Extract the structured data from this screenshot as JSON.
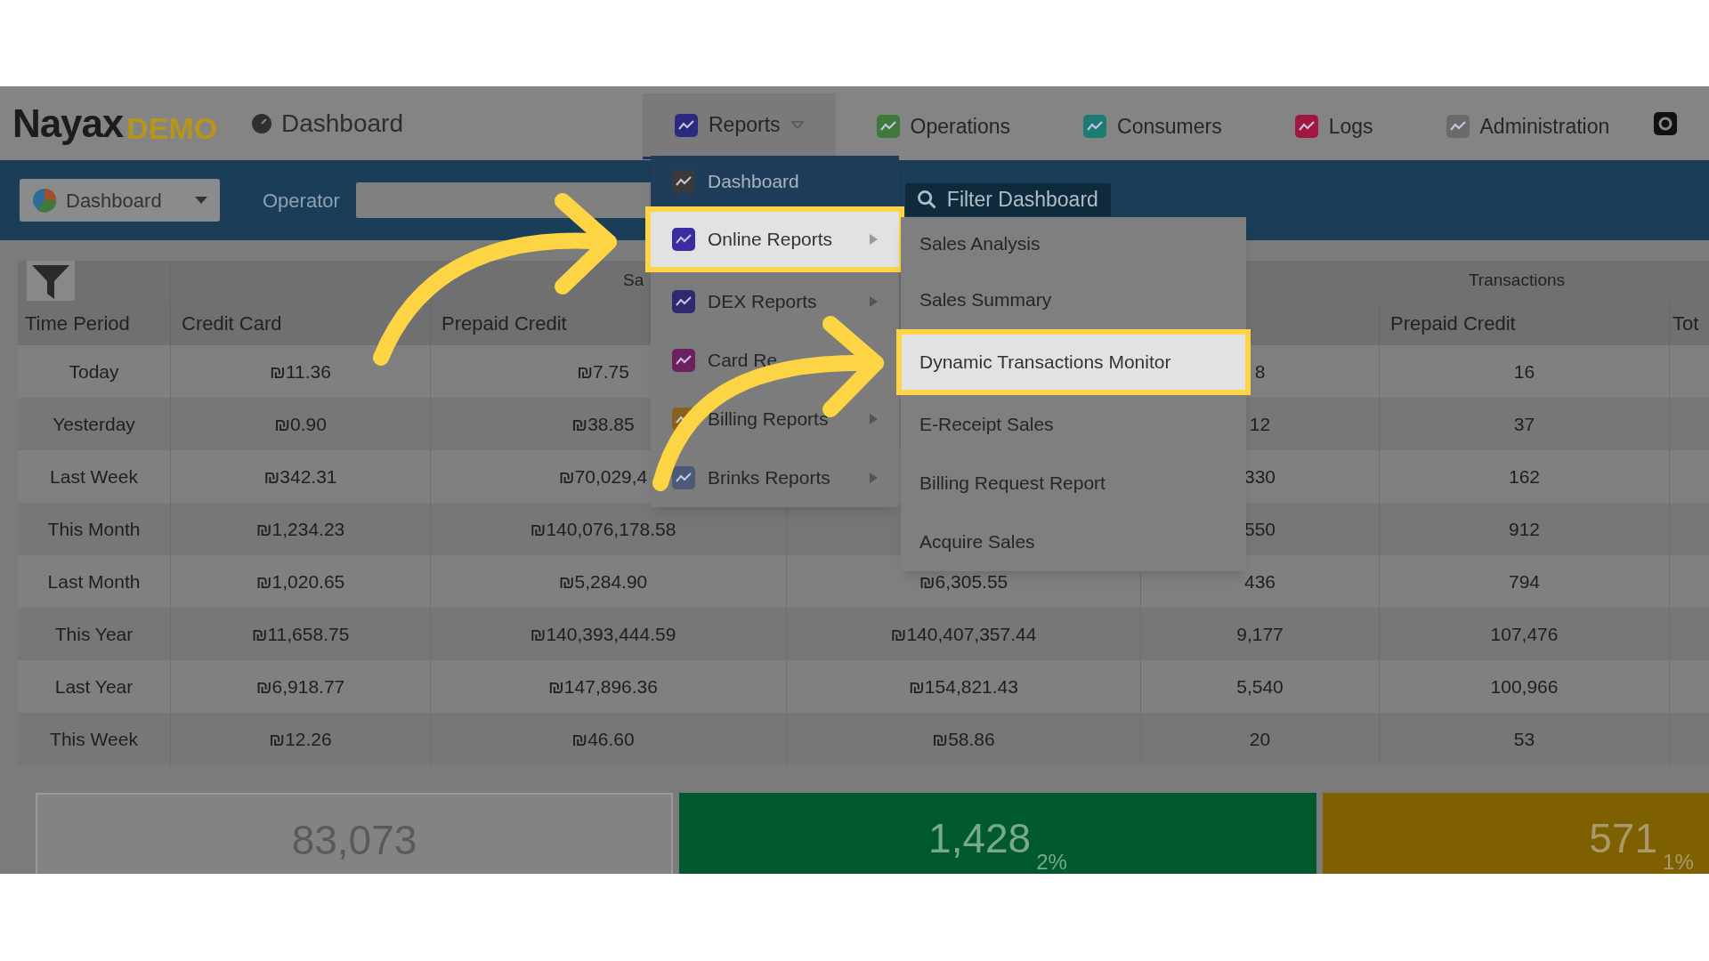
{
  "brand": {
    "name": "Nayax",
    "suffix": "DEMO"
  },
  "page_title": "Dashboard",
  "nav_tabs": [
    {
      "label": "Reports",
      "selected": true,
      "color": "#2c2a7e",
      "has_caret": true
    },
    {
      "label": "Operations",
      "selected": false,
      "color": "#3f7a3a",
      "has_caret": false
    },
    {
      "label": "Consumers",
      "selected": false,
      "color": "#1d7a75",
      "has_caret": false
    },
    {
      "label": "Logs",
      "selected": false,
      "color": "#a0183f",
      "has_caret": false
    },
    {
      "label": "Administration",
      "selected": false,
      "color": "#6a6a6a",
      "has_caret": false
    }
  ],
  "toolbar": {
    "dashboard_button": "Dashboard",
    "operator_label": "Operator",
    "filter_button": "Filter Dashboard"
  },
  "table": {
    "group_headers": [
      "Sa",
      "Transactions"
    ],
    "columns": [
      "Time Period",
      "Credit Card",
      "Prepaid Credit",
      null,
      null,
      "Prepaid Credit",
      "Tot"
    ],
    "rows": [
      [
        "Today",
        "₪11.36",
        "₪7.75",
        null,
        "8",
        "16"
      ],
      [
        "Yesterday",
        "₪0.90",
        "₪38.85",
        null,
        "12",
        "37"
      ],
      [
        "Last Week",
        "₪342.31",
        "₪70,029,4",
        null,
        "330",
        "162"
      ],
      [
        "This Month",
        "₪1,234.23",
        "₪140,076,178.58",
        null,
        "550",
        "912"
      ],
      [
        "Last Month",
        "₪1,020.65",
        "₪5,284.90",
        "₪6,305.55",
        "436",
        "794"
      ],
      [
        "This Year",
        "₪11,658.75",
        "₪140,393,444.59",
        "₪140,407,357.44",
        "9,177",
        "107,476"
      ],
      [
        "Last Year",
        "₪6,918.77",
        "₪147,896.36",
        "₪154,821.43",
        "5,540",
        "100,966"
      ],
      [
        "This Week",
        "₪12.26",
        "₪46.60",
        "₪58.86",
        "20",
        "53"
      ]
    ]
  },
  "stats": [
    {
      "value": "83,073",
      "kind": "plain"
    },
    {
      "value": "1,428",
      "percent": "2%",
      "kind": "success"
    },
    {
      "value": "571",
      "percent": "1%",
      "kind": "warning"
    }
  ],
  "reports_menu": [
    {
      "label": "Dashboard",
      "color": "#3a3a3a",
      "current": true,
      "selected": false,
      "has_submenu": false
    },
    {
      "label": "Online Reports",
      "color": "#3b2d9f",
      "current": false,
      "selected": true,
      "has_submenu": true
    },
    {
      "label": "DEX Reports",
      "color": "#2f2970",
      "current": false,
      "selected": false,
      "has_submenu": true
    },
    {
      "label": "Card Re",
      "color": "#6b2160",
      "current": false,
      "selected": false
    },
    {
      "label": "Billing Reports",
      "color": "#8a6020",
      "current": false,
      "selected": false,
      "has_submenu": true
    },
    {
      "label": "Brinks Reports",
      "color": "#4a5a78",
      "current": false,
      "selected": false,
      "has_submenu": true
    }
  ],
  "submenu": [
    {
      "label": "Sales Analysis",
      "selected": false
    },
    {
      "label": "Sales Summary",
      "selected": false
    },
    {
      "label": "Dynamic Transactions Monitor",
      "selected": true
    },
    {
      "label": "E-Receipt Sales",
      "selected": false
    },
    {
      "label": "Billing Request Report",
      "selected": false
    },
    {
      "label": "Acquire Sales",
      "selected": false
    }
  ]
}
